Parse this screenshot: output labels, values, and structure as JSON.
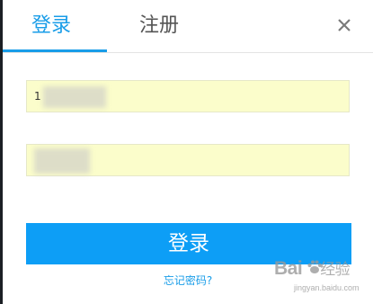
{
  "tabs": {
    "login_label": "登录",
    "register_label": "注册",
    "active": "login"
  },
  "close": {
    "icon": "close-icon"
  },
  "form": {
    "username_value": "1",
    "password_value": ""
  },
  "login_button_label": "登录",
  "forgot_password_label": "忘记密码?",
  "watermark": {
    "brand": "Bai",
    "brand_suffix": "经验",
    "url": "jingyan.baidu.com"
  },
  "colors": {
    "accent": "#199de8",
    "button": "#0d9ef6",
    "field_background": "#fbfdcb"
  }
}
